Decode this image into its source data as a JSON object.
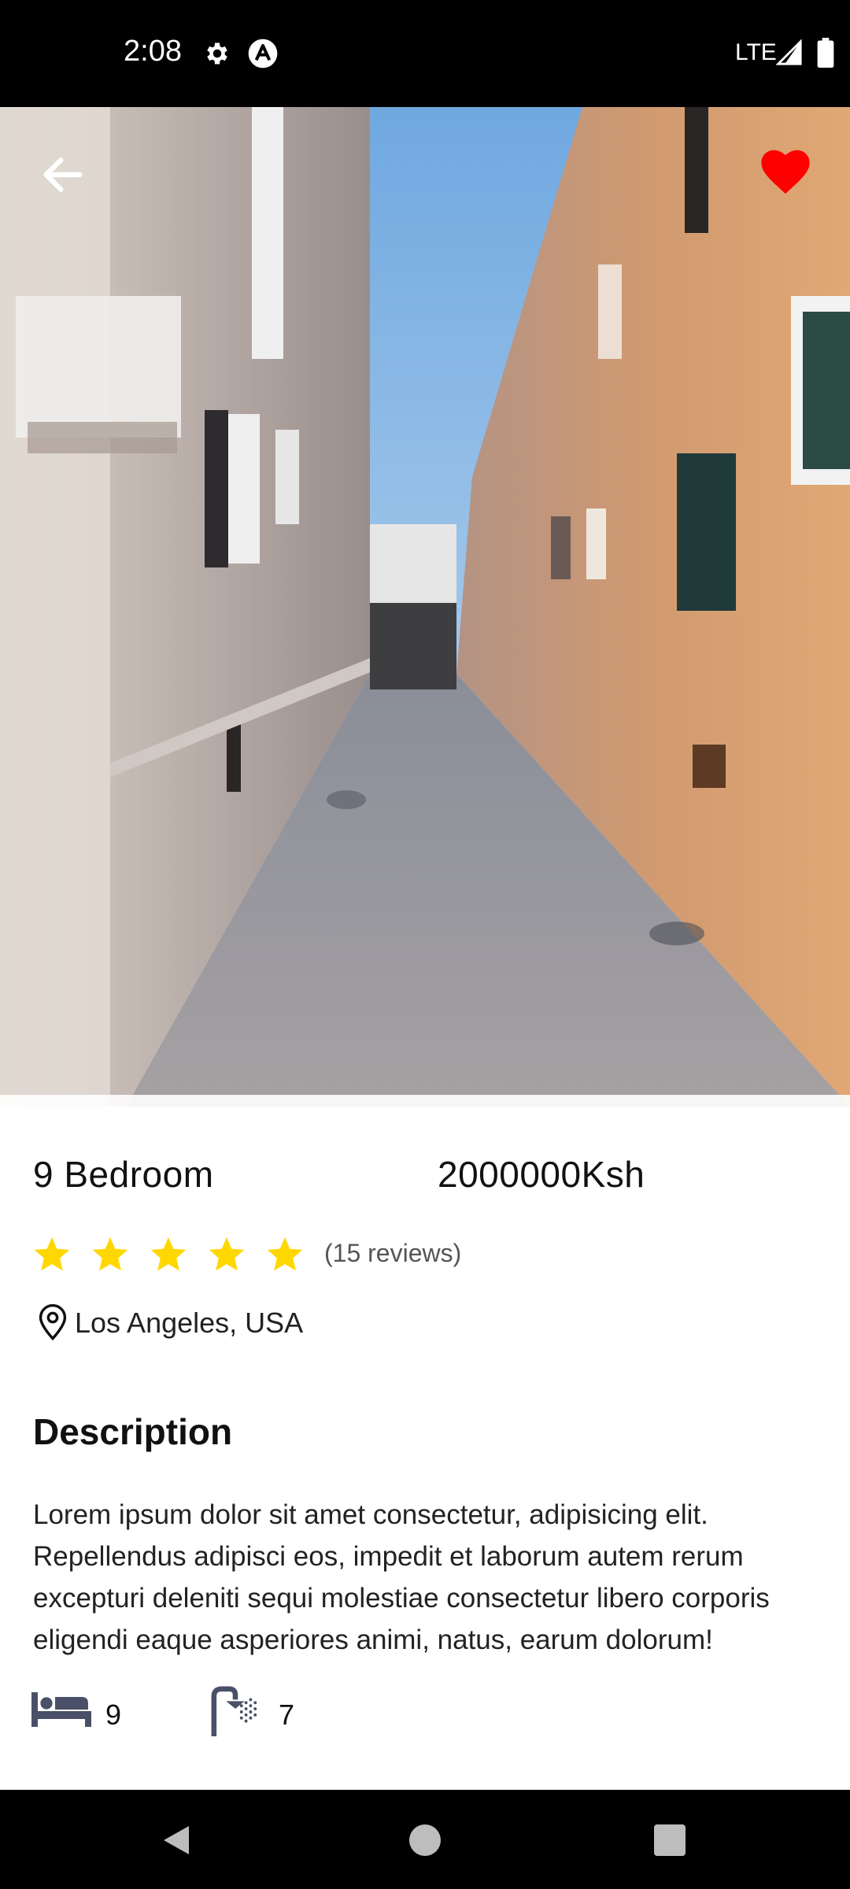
{
  "status_bar": {
    "time": "2:08",
    "network": "LTE",
    "icons": [
      "gear-icon",
      "a-icon",
      "signal-icon",
      "battery-icon"
    ]
  },
  "hero": {
    "image_description_icons": [
      "back-arrow-icon",
      "heart-icon"
    ],
    "favorite_color": "#FF0000"
  },
  "property": {
    "title": "9 Bedroom",
    "price": "2000000Ksh",
    "rating": 5,
    "rating_max": 5,
    "reviews": "(15 reviews)",
    "location": "Los Angeles, USA",
    "star_color": "#FFD700"
  },
  "description": {
    "heading": "Description",
    "text": "Lorem ipsum dolor sit amet consectetur, adipisicing elit. Repellendus adipisci eos, impedit et laborum autem rerum excepturi deleniti sequi molestiae consectetur libero corporis eligendi eaque asperiores animi, natus, earum dolorum!"
  },
  "amenities": {
    "bedrooms": "9",
    "bathrooms": "7",
    "icon_color": "#4A5068"
  },
  "nav_bar": {
    "icons": [
      "nav-back-icon",
      "nav-home-icon",
      "nav-recents-icon"
    ]
  }
}
